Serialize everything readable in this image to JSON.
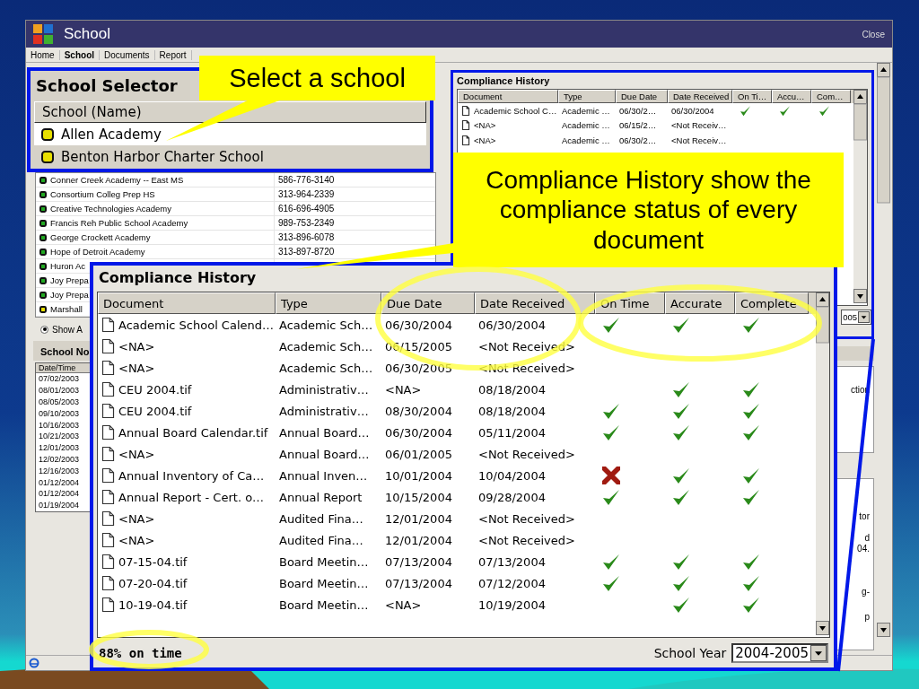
{
  "window": {
    "title": "School",
    "close": "Close"
  },
  "menu": [
    {
      "label": "Home",
      "selected": false
    },
    {
      "label": "School",
      "selected": true
    },
    {
      "label": "Documents",
      "selected": false
    },
    {
      "label": "Report",
      "selected": false
    }
  ],
  "school_list": {
    "rows": [
      {
        "name": "Conner Creek Academy -- East MS",
        "phone": "586-776-3140",
        "color": "#22aa22"
      },
      {
        "name": "Consortium Colleg Prep HS",
        "phone": "313-964-2339",
        "color": "#22aa22"
      },
      {
        "name": "Creative Technologies Academy",
        "phone": "616-696-4905",
        "color": "#22aa22"
      },
      {
        "name": "Francis Reh Public School Academy",
        "phone": "989-753-2349",
        "color": "#22aa22"
      },
      {
        "name": "George Crockett Academy",
        "phone": "313-896-6078",
        "color": "#22aa22"
      },
      {
        "name": "Hope of Detroit Academy",
        "phone": "313-897-8720",
        "color": "#22aa22"
      },
      {
        "name": "Huron Ac",
        "color": "#22aa22"
      },
      {
        "name": "Joy Prepa",
        "color": "#22aa22"
      },
      {
        "name": "Joy Prepa",
        "color": "#22aa22"
      },
      {
        "name": "Marshall",
        "color": "#e8e000"
      }
    ]
  },
  "show_all": {
    "label": "Show A",
    "selected": true
  },
  "notes": {
    "title": "School No",
    "column": "Date/Time",
    "rows": [
      "07/02/2003",
      "08/01/2003",
      "08/05/2003",
      "09/10/2003",
      "10/16/2003",
      "10/21/2003",
      "12/01/2003",
      "12/02/2003",
      "12/16/2003",
      "01/12/2004",
      "01/12/2004",
      "01/19/2004"
    ]
  },
  "compliance_small": {
    "title": "Compliance History",
    "columns": [
      "Document",
      "Type",
      "Due Date",
      "Date Received",
      "On Ti…",
      "Accu…",
      "Com…"
    ],
    "rows": [
      {
        "document": "Academic School C…",
        "type": "Academic …",
        "due": "06/30/2…",
        "received": "06/30/2004",
        "on_time": true,
        "accurate": true,
        "complete": true
      },
      {
        "document": "<NA>",
        "type": "Academic …",
        "due": "06/15/2…",
        "received": "<Not Receiv…"
      },
      {
        "document": "<NA>",
        "type": "Academic …",
        "due": "06/30/2…",
        "received": "<Not Receiv…"
      }
    ],
    "year": "005"
  },
  "side_fragments": [
    {
      "text": "ction"
    },
    {
      "text": "tor"
    },
    {
      "text": "d"
    },
    {
      "text": "04."
    },
    {
      "text": "g-"
    },
    {
      "text": "p"
    }
  ],
  "selector_zoom": {
    "title": "School Selector",
    "column": "School (Name)",
    "rows": [
      {
        "name": "Allen Academy",
        "selected": false,
        "color": "#e8e000"
      },
      {
        "name": "Benton Harbor Charter School",
        "selected": true,
        "color": "#e8e000"
      }
    ]
  },
  "compliance_zoom": {
    "title": "Compliance History",
    "columns": [
      "Document",
      "Type",
      "Due Date",
      "Date Received",
      "On Time",
      "Accurate",
      "Complete"
    ],
    "rows": [
      {
        "document": "Academic School Calend…",
        "type": "Academic Sch…",
        "due": "06/30/2004",
        "received": "06/30/2004",
        "on_time": true,
        "accurate": true,
        "complete": true
      },
      {
        "document": "<NA>",
        "type": "Academic Sch…",
        "due": "06/15/2005",
        "received": "<Not Received>"
      },
      {
        "document": "<NA>",
        "type": "Academic Sch…",
        "due": "06/30/2005",
        "received": "<Not Received>"
      },
      {
        "document": "CEU 2004.tif",
        "type": "Administrativ…",
        "due": "<NA>",
        "received": "08/18/2004",
        "accurate": true,
        "complete": true
      },
      {
        "document": "CEU 2004.tif",
        "type": "Administrativ…",
        "due": "08/30/2004",
        "received": "08/18/2004",
        "on_time": true,
        "accurate": true,
        "complete": true
      },
      {
        "document": "Annual Board Calendar.tif",
        "type": "Annual Board…",
        "due": "06/30/2004",
        "received": "05/11/2004",
        "on_time": true,
        "accurate": true,
        "complete": true
      },
      {
        "document": "<NA>",
        "type": "Annual Board…",
        "due": "06/01/2005",
        "received": "<Not Received>"
      },
      {
        "document": "Annual Inventory of Ca…",
        "type": "Annual Inven…",
        "due": "10/01/2004",
        "received": "10/04/2004",
        "on_time": false,
        "accurate": true,
        "complete": true
      },
      {
        "document": "Annual Report - Cert. o…",
        "type": "Annual Report",
        "due": "10/15/2004",
        "received": "09/28/2004",
        "on_time": true,
        "accurate": true,
        "complete": true
      },
      {
        "document": "<NA>",
        "type": "Audited Fina…",
        "due": "12/01/2004",
        "received": "<Not Received>"
      },
      {
        "document": "<NA>",
        "type": "Audited Fina…",
        "due": "12/01/2004",
        "received": "<Not Received>"
      },
      {
        "document": "07-15-04.tif",
        "type": "Board Meetin…",
        "due": "07/13/2004",
        "received": "07/13/2004",
        "on_time": true,
        "accurate": true,
        "complete": true
      },
      {
        "document": "07-20-04.tif",
        "type": "Board Meetin…",
        "due": "07/13/2004",
        "received": "07/12/2004",
        "on_time": true,
        "accurate": true,
        "complete": true
      },
      {
        "document": "10-19-04.tif",
        "type": "Board Meetin…",
        "due": "<NA>",
        "received": "10/19/2004",
        "accurate": true,
        "complete": true
      }
    ],
    "summary": "88% on time",
    "year_label": "School Year",
    "year": "2004-2005"
  },
  "callouts": [
    {
      "text": "Select a school"
    },
    {
      "text": "Compliance History show the compliance status of every document"
    }
  ]
}
